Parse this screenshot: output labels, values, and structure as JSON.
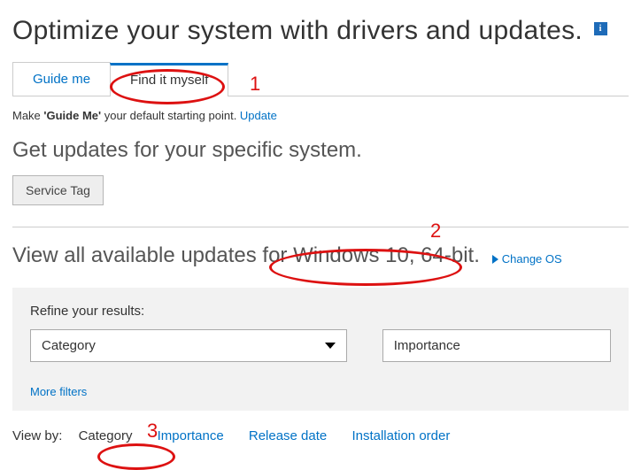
{
  "title": "Optimize your system with drivers and updates.",
  "tabs": {
    "guide_me": "Guide me",
    "find_myself": "Find it myself"
  },
  "default_line_prefix": "Make ",
  "default_line_bold": "'Guide Me'",
  "default_line_suffix": " your default starting point. ",
  "update_link": "Update",
  "get_updates_heading": "Get updates for your specific system.",
  "service_tag_btn": "Service Tag",
  "view_all_prefix": "View all available updates for ",
  "os_text": "Windows 10, 64-bit.",
  "change_os": "Change OS",
  "refine_label": "Refine your results:",
  "select_category": "Category",
  "select_importance": "Importance",
  "more_filters": "More filters",
  "view_by_label": "View by:",
  "view_by": {
    "category": "Category",
    "importance": "Importance",
    "release": "Release date",
    "install": "Installation order"
  },
  "annotations": {
    "n1": "1",
    "n2": "2",
    "n3": "3"
  }
}
